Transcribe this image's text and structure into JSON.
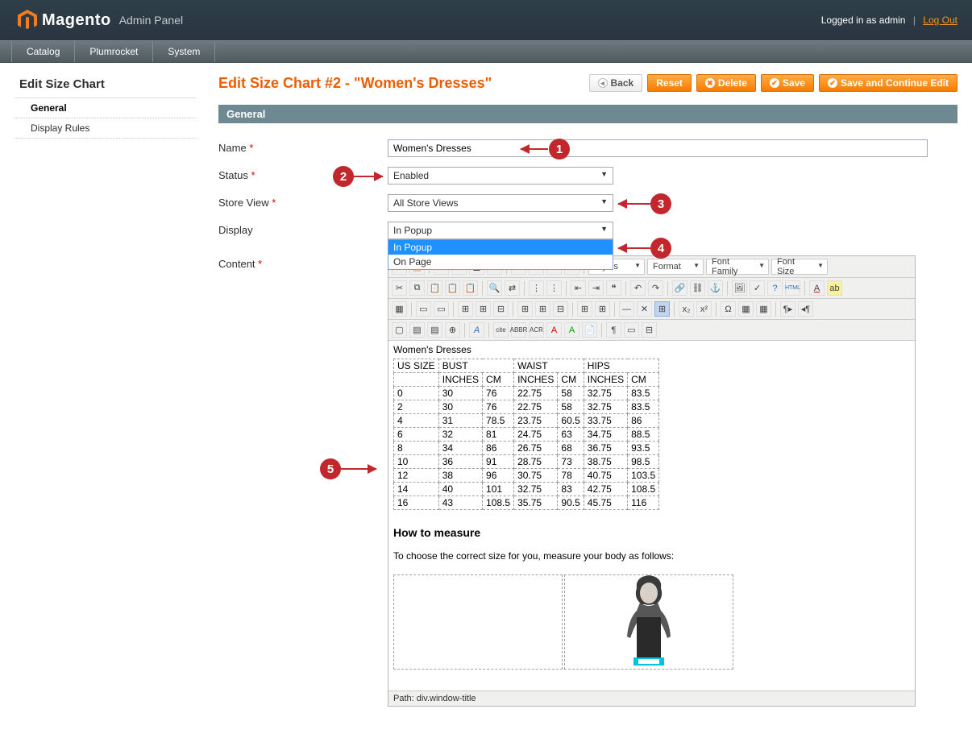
{
  "header": {
    "brand": "Magento",
    "panel": "Admin Panel",
    "logged_in": "Logged in as admin",
    "logout": "Log Out"
  },
  "nav": {
    "items": [
      "Catalog",
      "Plumrocket",
      "System"
    ]
  },
  "sidebar": {
    "title": "Edit Size Chart",
    "items": [
      {
        "label": "General",
        "active": true
      },
      {
        "label": "Display Rules",
        "active": false
      }
    ]
  },
  "page": {
    "title": "Edit Size Chart #2 - \"Women's Dresses\"",
    "buttons": {
      "back": "Back",
      "reset": "Reset",
      "delete": "Delete",
      "save": "Save",
      "savecont": "Save and Continue Edit"
    }
  },
  "section_bar": "General",
  "form": {
    "name_label": "Name",
    "name_value": "Women's Dresses",
    "status_label": "Status",
    "status_value": "Enabled",
    "storeview_label": "Store View",
    "storeview_value": "All Store Views",
    "display_label": "Display",
    "display_value": "In Popup",
    "display_options": [
      "In Popup",
      "On Page"
    ],
    "content_label": "Content"
  },
  "callouts": {
    "c1": "1",
    "c2": "2",
    "c3": "3",
    "c4": "4",
    "c5": "5"
  },
  "editor_selects": {
    "styles": "Styles",
    "format": "Format",
    "fontfam": "Font Family",
    "fontsize": "Font Size"
  },
  "content": {
    "title": "Women's Dresses",
    "col_us": "US SIZE",
    "col_bust": "BUST",
    "col_waist": "WAIST",
    "col_hips": "HIPS",
    "sub_in": "INCHES",
    "sub_cm": "CM",
    "rows": [
      {
        "s": "0",
        "bi": "30",
        "bc": "76",
        "wi": "22.75",
        "wc": "58",
        "hi": "32.75",
        "hc": "83.5"
      },
      {
        "s": "2",
        "bi": "30",
        "bc": "76",
        "wi": "22.75",
        "wc": "58",
        "hi": "32.75",
        "hc": "83.5"
      },
      {
        "s": "4",
        "bi": "31",
        "bc": "78.5",
        "wi": "23.75",
        "wc": "60.5",
        "hi": "33.75",
        "hc": "86"
      },
      {
        "s": "6",
        "bi": "32",
        "bc": "81",
        "wi": "24.75",
        "wc": "63",
        "hi": "34.75",
        "hc": "88.5"
      },
      {
        "s": "8",
        "bi": "34",
        "bc": "86",
        "wi": "26.75",
        "wc": "68",
        "hi": "36.75",
        "hc": "93.5"
      },
      {
        "s": "10",
        "bi": "36",
        "bc": "91",
        "wi": "28.75",
        "wc": "73",
        "hi": "38.75",
        "hc": "98.5"
      },
      {
        "s": "12",
        "bi": "38",
        "bc": "96",
        "wi": "30.75",
        "wc": "78",
        "hi": "40.75",
        "hc": "103.5"
      },
      {
        "s": "14",
        "bi": "40",
        "bc": "101",
        "wi": "32.75",
        "wc": "83",
        "hi": "42.75",
        "hc": "108.5"
      },
      {
        "s": "16",
        "bi": "43",
        "bc": "108.5",
        "wi": "35.75",
        "wc": "90.5",
        "hi": "45.75",
        "hc": "116"
      }
    ],
    "how_title": "How to measure",
    "how_desc": "To choose the correct size for you, measure your body as follows:",
    "path": "Path: div.window-title"
  }
}
